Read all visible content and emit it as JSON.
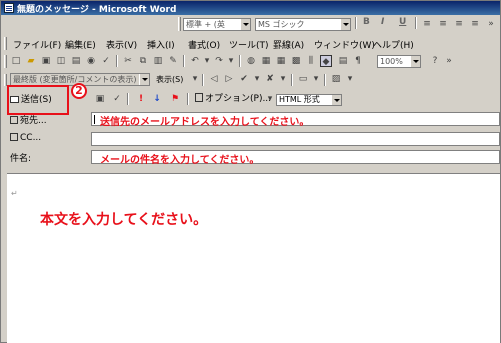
{
  "window": {
    "title": "無題のメッセージ - Microsoft Word"
  },
  "format_bar": {
    "style_value": "標準 + (英",
    "font_value": "MS ゴシック",
    "bold": "B",
    "italic": "I",
    "underline": "U"
  },
  "menu": {
    "items": [
      {
        "label": "ファイル(F)"
      },
      {
        "label": "編集(E)"
      },
      {
        "label": "表示(V)"
      },
      {
        "label": "挿入(I)"
      },
      {
        "label": "書式(O)"
      },
      {
        "label": "ツール(T)"
      },
      {
        "label": "罫線(A)"
      },
      {
        "label": "ウィンドウ(W)"
      },
      {
        "label": "ヘルプ(H)"
      }
    ]
  },
  "standard_bar": {
    "zoom": "100%"
  },
  "review_bar": {
    "view_label": "最終版 (変更箇所/コメントの表示)",
    "show_label": "表示(S)"
  },
  "send_bar": {
    "send_label": "送信(S)",
    "options_label": "オプション(P)...",
    "format_value": "HTML 形式",
    "step_number": "2"
  },
  "fields": {
    "to_label": "宛先...",
    "to_hint": "送信先のメールアドレスを入力してください。",
    "cc_label": "CC...",
    "subject_label": "件名:",
    "subject_hint": "メールの件名を入力してください。"
  },
  "body": {
    "paragraph_mark": "↵",
    "instruction": "本文を入力してください。"
  },
  "colors": {
    "annotation": "#e8101a",
    "title_bar": "#0a246a"
  }
}
